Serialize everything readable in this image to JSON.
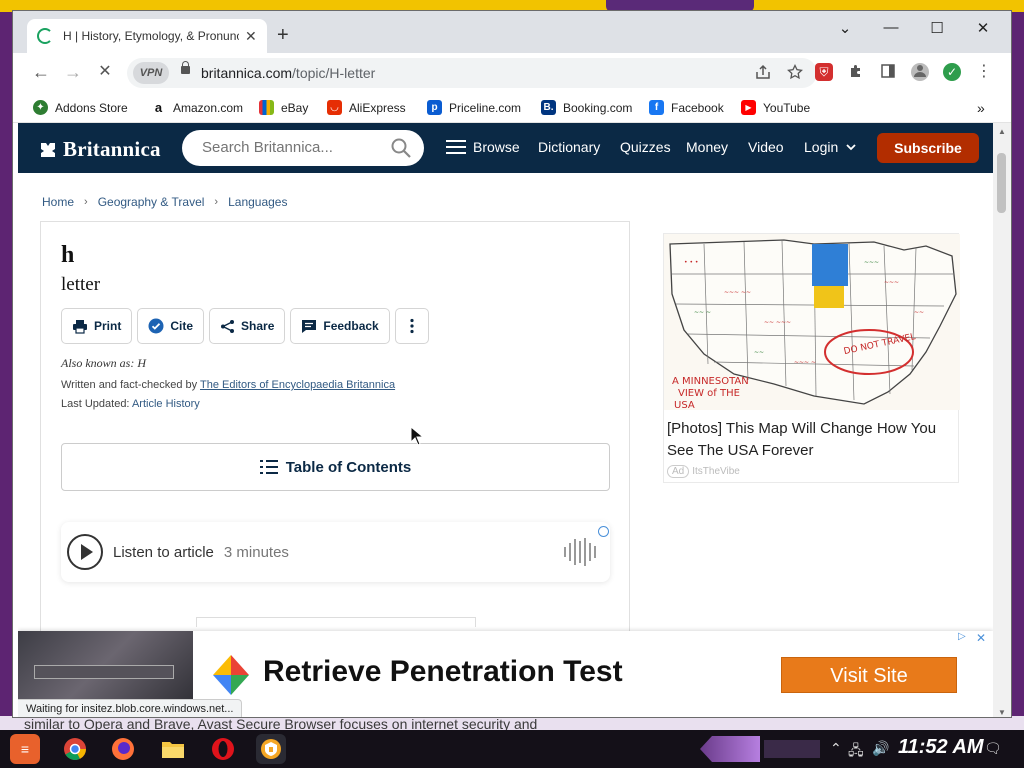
{
  "desktop": {
    "background_text": "similar to Opera and Brave, Avast Secure Browser focuses on internet security and",
    "accent": "#5d2472"
  },
  "browser": {
    "tab_title": "H | History, Etymology, & Pronunciation",
    "new_tab": "+",
    "window_controls": {
      "minimize": "—",
      "maximize": "☐",
      "close": "✕",
      "dropdown": "⌄"
    },
    "nav": {
      "back": "←",
      "forward": "→",
      "reload": "✕"
    },
    "vpn_label": "VPN",
    "url_domain": "britannica.com",
    "url_path": "/topic/H-letter",
    "omnibox_icons": [
      "share-icon",
      "star-icon"
    ],
    "more": "⋮",
    "bookmarks": [
      {
        "label": "Addons Store",
        "icon": "addons-icon",
        "color": "#2e7d32"
      },
      {
        "label": "Amazon.com",
        "icon": "amazon-icon",
        "color": "#111111"
      },
      {
        "label": "eBay",
        "icon": "ebay-icon",
        "color": "#e53238"
      },
      {
        "label": "AliExpress",
        "icon": "aliexpress-icon",
        "color": "#e62e04"
      },
      {
        "label": "Priceline.com",
        "icon": "priceline-icon",
        "color": "#0a5cd1"
      },
      {
        "label": "Booking.com",
        "icon": "booking-icon",
        "color": "#003580"
      },
      {
        "label": "Facebook",
        "icon": "facebook-icon",
        "color": "#1877f2"
      },
      {
        "label": "YouTube",
        "icon": "youtube-icon",
        "color": "#ff0000"
      }
    ],
    "bookmarks_overflow": "»",
    "status_text": "Waiting for insitez.blob.core.windows.net..."
  },
  "site": {
    "logo": "Britannica",
    "search_placeholder": "Search Britannica...",
    "nav": {
      "browse": "Browse",
      "dictionary": "Dictionary",
      "quizzes": "Quizzes",
      "money": "Money",
      "video": "Video",
      "login": "Login",
      "subscribe": "Subscribe"
    },
    "brand_color": "#0b2945",
    "subscribe_color": "#b22d00"
  },
  "breadcrumbs": [
    "Home",
    "Geography & Travel",
    "Languages"
  ],
  "article": {
    "title": "h",
    "subtitle": "letter",
    "actions": {
      "print": "Print",
      "cite": "Cite",
      "share": "Share",
      "feedback": "Feedback"
    },
    "aka_label": "Also known as:",
    "aka_value": "H",
    "written_prefix": "Written and fact-checked by",
    "written_by": "The Editors of Encyclopaedia Britannica",
    "updated_prefix": "Last Updated:",
    "updated_link": "Article History",
    "toc": "Table of Contents",
    "listen_label": "Listen to article",
    "listen_duration": "3 minutes"
  },
  "side_ad": {
    "image_caption_lines": [
      "A MINNESOTAN",
      "VIEW of THE",
      "USA"
    ],
    "stamp": "DO NOT TRAVEL",
    "text": "[Photos] This Map Will Change How You See The USA Forever",
    "badge": "Ad",
    "source": "ItsTheVibe"
  },
  "bottom_ad": {
    "headline": "Retrieve Penetration Test",
    "cta": "Visit Site",
    "cta_color": "#e87a1a"
  },
  "taskbar": {
    "clock": "11:52 AM",
    "apps": [
      "start-icon",
      "chrome-icon",
      "firefox-icon",
      "file-explorer-icon",
      "opera-icon",
      "avast-secure-browser-icon"
    ]
  }
}
